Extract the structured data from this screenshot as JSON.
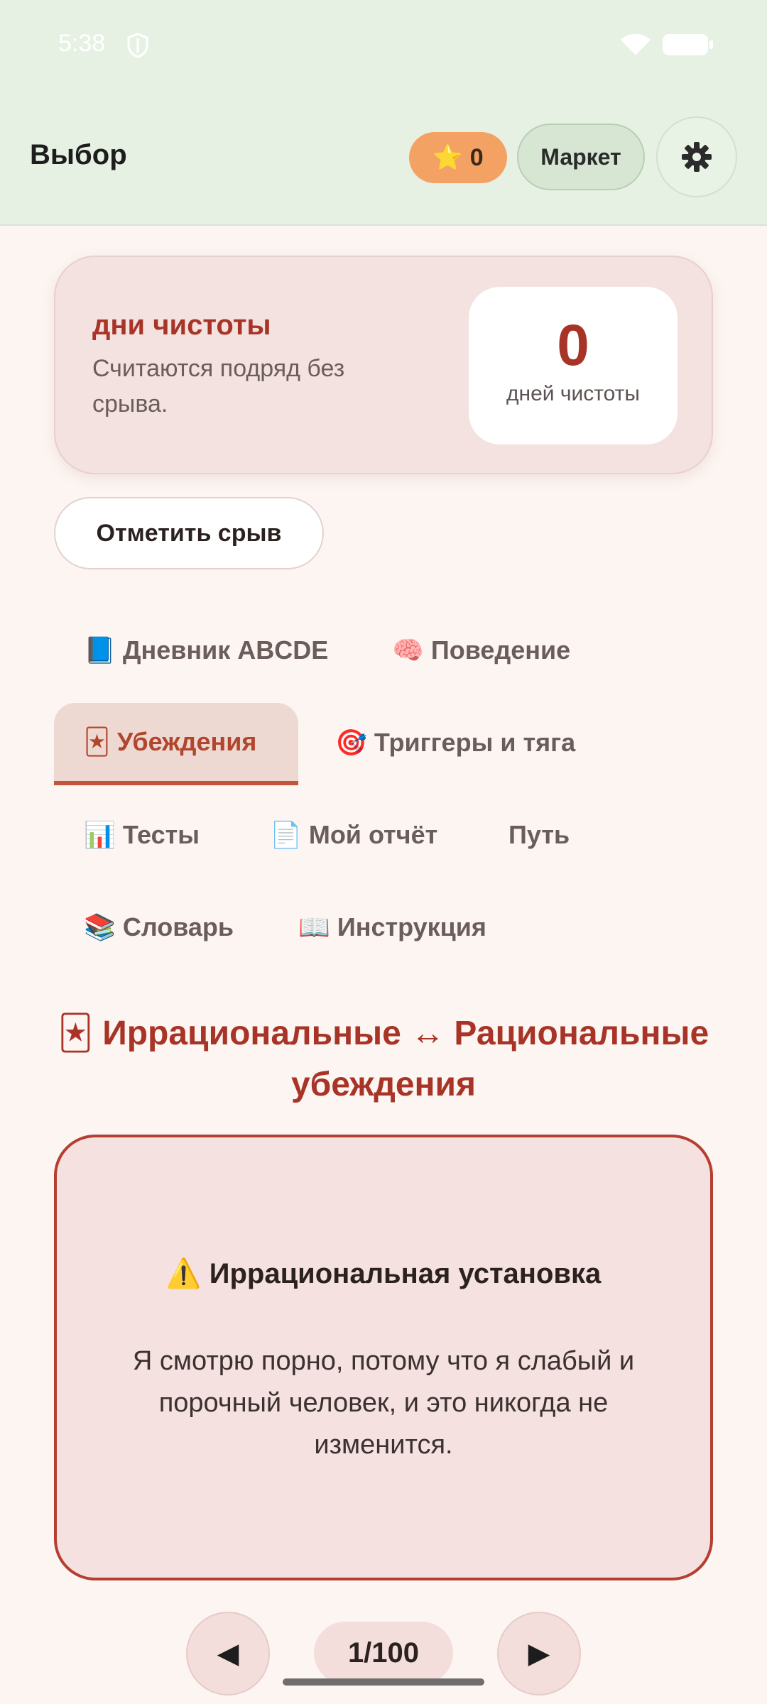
{
  "status": {
    "time": "5:38"
  },
  "header": {
    "title": "Выбор",
    "stars_icon": "⭐",
    "stars_count": "0",
    "market_label": "Маркет"
  },
  "streak": {
    "title": "дни чистоты",
    "description": "Считаются подряд без срыва.",
    "value": "0",
    "unit": "дней чистоты"
  },
  "relapse_button": "Отметить срыв",
  "tabs": [
    {
      "icon": "📘",
      "label": "Дневник ABCDE"
    },
    {
      "icon": "🧠",
      "label": "Поведение"
    },
    {
      "icon": "🃏",
      "label": "Убеждения"
    },
    {
      "icon": "🎯",
      "label": "Триггеры и тяга"
    },
    {
      "icon": "📊",
      "label": "Тесты"
    },
    {
      "icon": "📄",
      "label": "Мой отчёт"
    },
    {
      "icon": "",
      "label": "Путь"
    },
    {
      "icon": "📚",
      "label": "Словарь"
    },
    {
      "icon": "📖",
      "label": "Инструкция"
    }
  ],
  "section": {
    "icon": "🃏",
    "title": "Иррациональные ↔ Рациональные убеждения"
  },
  "card": {
    "kind_icon": "⚠️",
    "kind": "Иррациональная установка",
    "text": "Я смотрю порно, потому что я слабый и порочный человек, и это никогда не изменится."
  },
  "pager": {
    "prev": "◀",
    "counter": "1/100",
    "next": "▶"
  }
}
